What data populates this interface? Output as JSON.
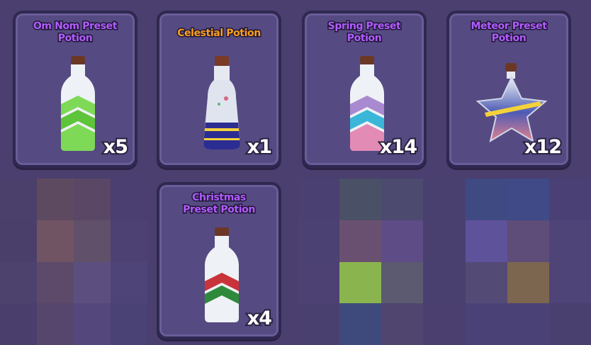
{
  "colors": {
    "background": "#4a3f6e",
    "card": "#564a82",
    "card_border": "#2f2850",
    "title_purple": "#b15cff",
    "title_orange": "#ff9f1a",
    "qty_text": "#ffffff"
  },
  "inventory": {
    "items": [
      {
        "name": "Om Nom Preset Potion",
        "lines": [
          "Om Nom Preset",
          "Potion"
        ],
        "quantity": "x5",
        "title_color": "#b15cff",
        "icon": "green-chevron-potion-icon"
      },
      {
        "name": "Celestial Potion",
        "lines": [
          "Celestial Potion",
          ""
        ],
        "quantity": "x1",
        "title_color": "#ff9f1a",
        "icon": "celestial-potion-icon"
      },
      {
        "name": "Spring Preset Potion",
        "lines": [
          "Spring Preset",
          "Potion"
        ],
        "quantity": "x14",
        "title_color": "#b15cff",
        "icon": "pink-chevron-potion-icon"
      },
      {
        "name": "Meteor Preset Potion",
        "lines": [
          "Meteor Preset",
          "Potion"
        ],
        "quantity": "x12",
        "title_color": "#b15cff",
        "icon": "star-potion-icon"
      },
      {
        "name": "Christmas Preset Potion",
        "lines": [
          "Christmas",
          "Preset Potion"
        ],
        "quantity": "x4",
        "title_color": "#b15cff",
        "icon": "red-green-chevron-potion-icon"
      }
    ]
  }
}
